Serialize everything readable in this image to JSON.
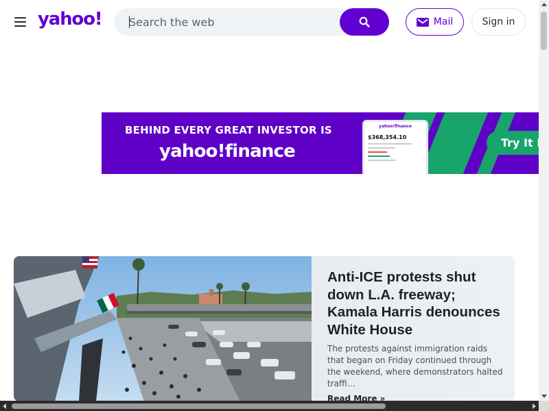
{
  "header": {
    "logo_text": "yahoo!",
    "menu_icon": "hamburger-menu-icon",
    "search": {
      "placeholder": "Search the web",
      "value": "",
      "button_icon": "search-icon"
    },
    "mail": {
      "label": "Mail",
      "icon": "envelope-icon"
    },
    "sign_in": {
      "label": "Sign in"
    }
  },
  "ad": {
    "headline": "BEHIND EVERY GREAT INVESTOR IS",
    "brand": "yahoo!finance",
    "cta": "Try It N",
    "phone": {
      "app_title": "yahoo!finance",
      "total": "$368,354.10"
    }
  },
  "story": {
    "title": "Anti-ICE protests shut down L.A. freeway; Kamala Harris denounces White House",
    "summary": "The protests against immigration raids that began on Friday continued through the weekend, where demonstrators halted traffi…",
    "read_more": "Read More »"
  },
  "colors": {
    "brand_purple": "#6001d2",
    "ad_background": "#5f00c7",
    "ad_accent_green": "#18a46a",
    "text_dark": "#232a31",
    "search_background": "#f0f3f5"
  }
}
